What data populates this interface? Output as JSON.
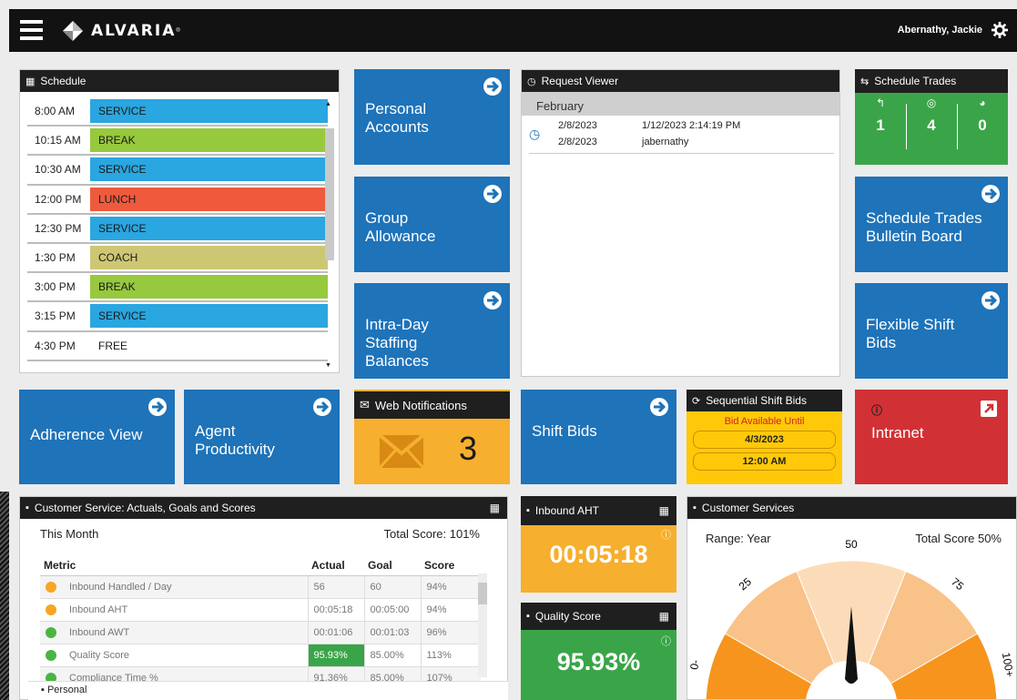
{
  "app": {
    "brand": "ALVARIA",
    "user": "Abernathy, Jackie"
  },
  "schedule": {
    "title": "Schedule",
    "rows": [
      {
        "time": "8:00 AM",
        "activity": "SERVICE",
        "color": "#2aa6e0"
      },
      {
        "time": "10:15 AM",
        "activity": "BREAK",
        "color": "#96c93d"
      },
      {
        "time": "10:30 AM",
        "activity": "SERVICE",
        "color": "#2aa6e0"
      },
      {
        "time": "12:00 PM",
        "activity": "LUNCH",
        "color": "#ef5a3c"
      },
      {
        "time": "12:30 PM",
        "activity": "SERVICE",
        "color": "#2aa6e0"
      },
      {
        "time": "1:30 PM",
        "activity": "COACH",
        "color": "#cdc774"
      },
      {
        "time": "3:00 PM",
        "activity": "BREAK",
        "color": "#96c93d"
      },
      {
        "time": "3:15 PM",
        "activity": "SERVICE",
        "color": "#2aa6e0"
      },
      {
        "time": "4:30 PM",
        "activity": "FREE",
        "color": "#ffffff"
      }
    ]
  },
  "tiles": {
    "personal_accounts": "Personal Accounts",
    "group_allowance": "Group Allowance",
    "intraday": "Intra-Day Staffing Balances",
    "adherence": "Adherence View",
    "agent_productivity": "Agent Productivity",
    "shift_bids": "Shift Bids",
    "bulletin": "Schedule Trades Bulletin Board",
    "flexible": "Flexible Shift Bids",
    "intranet": "Intranet"
  },
  "request_viewer": {
    "title": "Request Viewer",
    "month": "February",
    "entry": {
      "date1": "2/8/2023",
      "date2": "2/8/2023",
      "submitted": "1/12/2023 2:14:19 PM",
      "user": "jabernathy"
    }
  },
  "schedule_trades": {
    "title": "Schedule Trades",
    "counts": [
      "1",
      "4",
      "0"
    ]
  },
  "web_notifications": {
    "title": "Web Notifications",
    "count": "3"
  },
  "sequential": {
    "title": "Sequential Shift Bids",
    "note": "Bid Available Until",
    "date": "4/3/2023",
    "time": "12:00 AM"
  },
  "customer_service": {
    "title": "Customer Service: Actuals, Goals and Scores",
    "period": "This Month",
    "total": "Total Score: 101%",
    "headers": [
      "Metric",
      "Actual",
      "Goal",
      "Score"
    ],
    "rows": [
      {
        "metric": "Inbound Handled / Day",
        "actual": "56",
        "goal": "60",
        "score": "94%",
        "status": "warn"
      },
      {
        "metric": "Inbound AHT",
        "actual": "00:05:18",
        "goal": "00:05:00",
        "score": "94%",
        "status": "warn"
      },
      {
        "metric": "Inbound AWT",
        "actual": "00:01:06",
        "goal": "00:01:03",
        "score": "96%",
        "status": "ok"
      },
      {
        "metric": "Quality Score",
        "actual": "95.93%",
        "goal": "85.00%",
        "score": "113%",
        "status": "ok"
      },
      {
        "metric": "Compliance Time %",
        "actual": "91.36%",
        "goal": "85.00%",
        "score": "107%",
        "status": "ok"
      }
    ]
  },
  "inbound_aht": {
    "title": "Inbound AHT",
    "value": "00:05:18"
  },
  "quality": {
    "title": "Quality Score",
    "value": "95.93%"
  },
  "customer_services": {
    "title": "Customer Services",
    "range": "Range: Year",
    "total": "Total Score 50%",
    "ticks": [
      "0-",
      "25",
      "50",
      "75",
      "100+"
    ],
    "needle_value": 50
  },
  "footer": {
    "label": "Personal"
  }
}
